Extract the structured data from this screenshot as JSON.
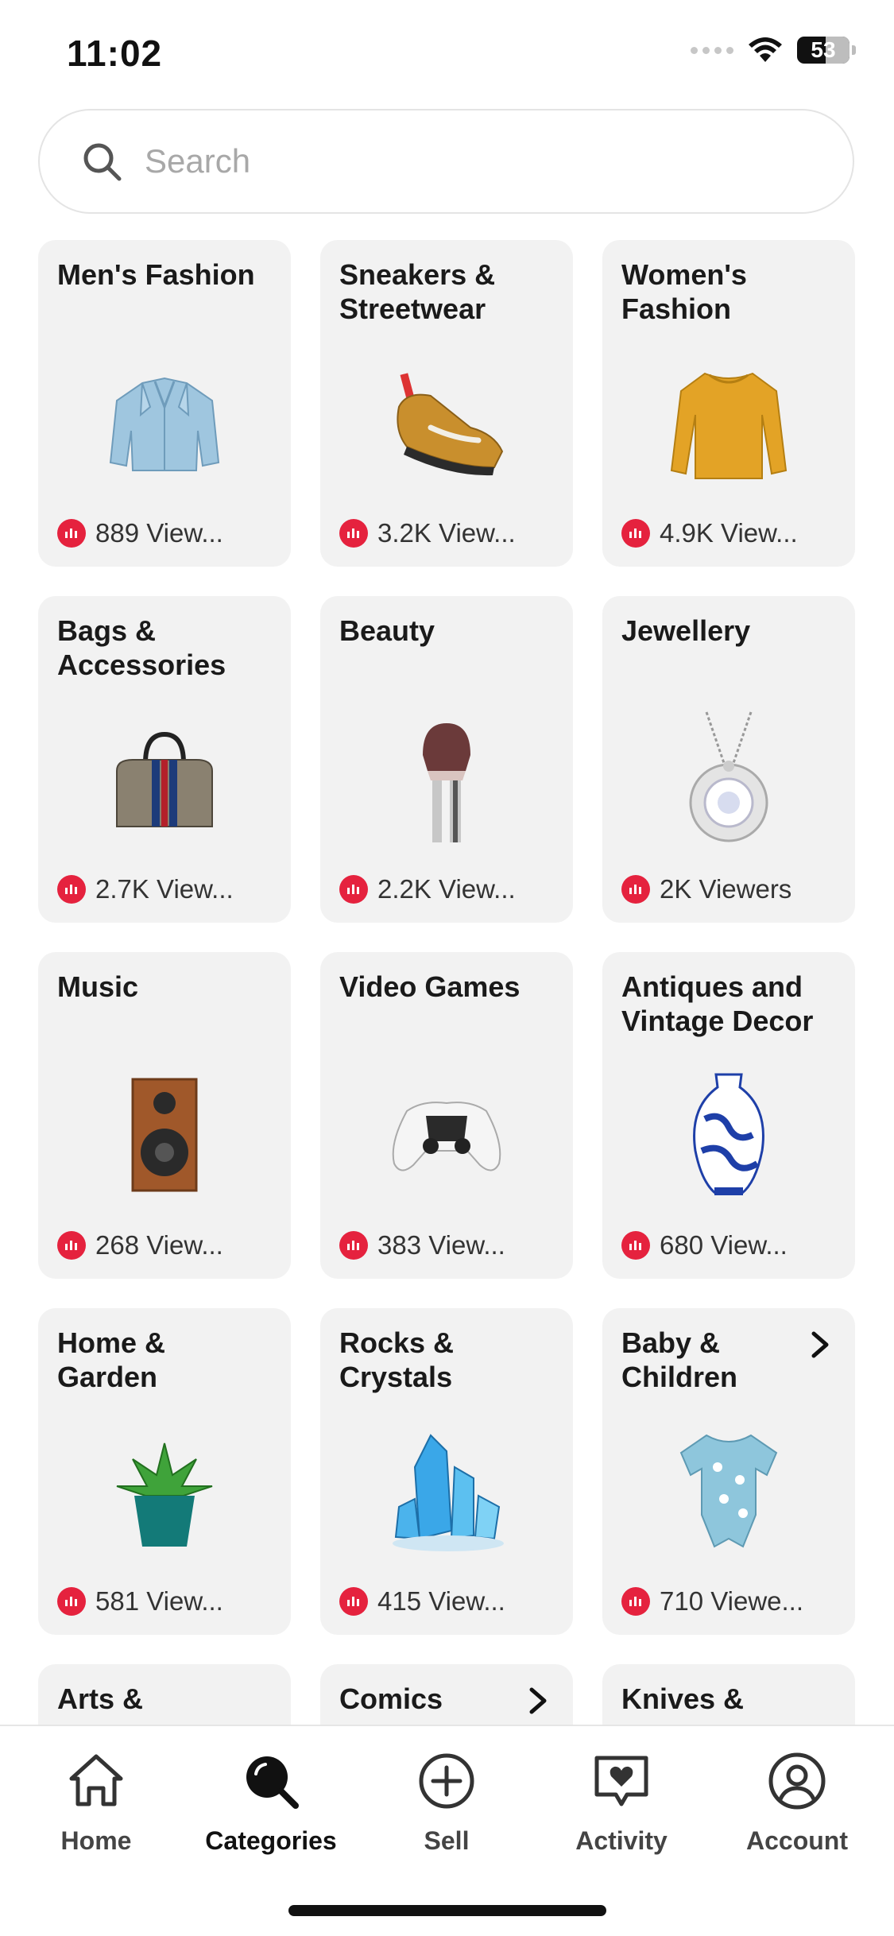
{
  "status_bar": {
    "time": "11:02",
    "battery": "53"
  },
  "search": {
    "placeholder": "Search"
  },
  "categories": [
    {
      "title": "Men's Fashion",
      "viewers": "889 View...",
      "icon": "jacket-image",
      "chevron": false
    },
    {
      "title": "Sneakers & Streetwear",
      "viewers": "3.2K View...",
      "icon": "sneaker-image",
      "chevron": false
    },
    {
      "title": "Women's Fashion",
      "viewers": "4.9K View...",
      "icon": "sweater-image",
      "chevron": false
    },
    {
      "title": "Bags & Accessories",
      "viewers": "2.7K View...",
      "icon": "handbag-image",
      "chevron": false
    },
    {
      "title": "Beauty",
      "viewers": "2.2K View...",
      "icon": "makeup-brush-image",
      "chevron": false
    },
    {
      "title": "Jewellery",
      "viewers": "2K Viewers",
      "icon": "pendant-necklace-image",
      "chevron": false
    },
    {
      "title": "Music",
      "viewers": "268 View...",
      "icon": "speaker-image",
      "chevron": false
    },
    {
      "title": "Video Games",
      "viewers": "383 View...",
      "icon": "game-controller-image",
      "chevron": false
    },
    {
      "title": "Antiques and Vintage Decor",
      "viewers": "680 View...",
      "icon": "porcelain-vase-image",
      "chevron": false
    },
    {
      "title": "Home & Garden",
      "viewers": "581 View...",
      "icon": "potted-succulent-image",
      "chevron": false
    },
    {
      "title": "Rocks & Crystals",
      "viewers": "415 View...",
      "icon": "blue-crystal-image",
      "chevron": false
    },
    {
      "title": "Baby & Children",
      "viewers": "710 Viewe...",
      "icon": "baby-onesie-image",
      "chevron": true
    },
    {
      "title": "Arts &",
      "viewers": "",
      "icon": "",
      "chevron": false
    },
    {
      "title": "Comics",
      "viewers": "",
      "icon": "",
      "chevron": true
    },
    {
      "title": "Knives &",
      "viewers": "",
      "icon": "",
      "chevron": false
    }
  ],
  "nav": {
    "home": "Home",
    "categories": "Categories",
    "sell": "Sell",
    "activity": "Activity",
    "account": "Account",
    "active": "categories"
  },
  "colors": {
    "live": "#e5223e",
    "card_bg": "#f2f2f2"
  }
}
